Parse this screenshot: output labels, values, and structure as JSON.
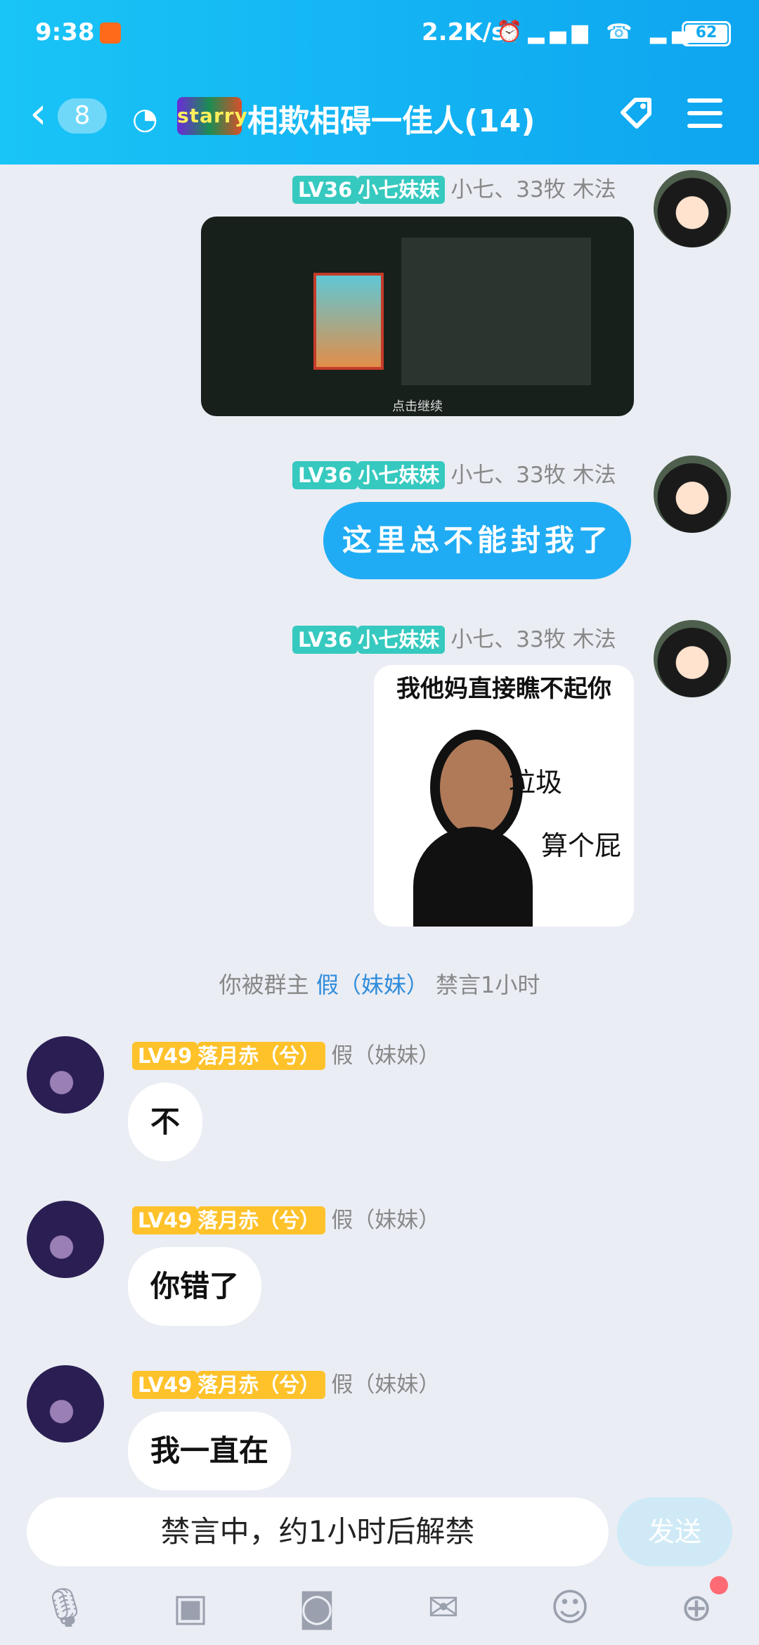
{
  "status_bar": {
    "time": "9:38",
    "network_speed": "2.2K/s",
    "battery": "62"
  },
  "header": {
    "back_icon": "chevron-left-icon",
    "unread_count": "8",
    "listen_icon": "ear-icon",
    "badge_text": "starry",
    "title": "相欺相碍一佳人(14)",
    "tag_icon": "tag-icon",
    "menu_icon": "menu-icon"
  },
  "messages": [
    {
      "level": "LV36",
      "name": "小七妹妹",
      "meta": "小七、33牧 木法",
      "type": "image",
      "image_footer": "点击继续"
    },
    {
      "level": "LV36",
      "name": "小七妹妹",
      "meta": "小七、33牧 木法",
      "type": "text",
      "text": "这里总不能封我了"
    },
    {
      "level": "LV36",
      "name": "小七妹妹",
      "meta": "小七、33牧 木法",
      "type": "sticker",
      "sticker_top": "我他妈直接瞧不起你",
      "sticker_line1": "垃圾",
      "sticker_line2": "算个屁"
    }
  ],
  "system_notice": {
    "prefix": "你被群主",
    "name": "假（妹妹）",
    "suffix": "禁言1小时"
  },
  "messages2": [
    {
      "level": "LV49",
      "name": "落月赤（兮）",
      "meta": "假（妹妹）",
      "text": "不"
    },
    {
      "level": "LV49",
      "name": "落月赤（兮）",
      "meta": "假（妹妹）",
      "text": "你错了"
    },
    {
      "level": "LV49",
      "name": "落月赤（兮）",
      "meta": "假（妹妹）",
      "text": "我一直在"
    }
  ],
  "input": {
    "status_text": "禁言中，约1小时后解禁",
    "send_label": "发送"
  },
  "toolbar": [
    "microphone-icon",
    "image-icon",
    "camera-icon",
    "red-packet-icon",
    "emoji-icon",
    "plus-icon"
  ],
  "colors": {
    "header": "#0ea5f0",
    "bubble_blue": "#20acf4",
    "level_teal": "#36c9bf",
    "level_gold": "#ffc22b"
  }
}
